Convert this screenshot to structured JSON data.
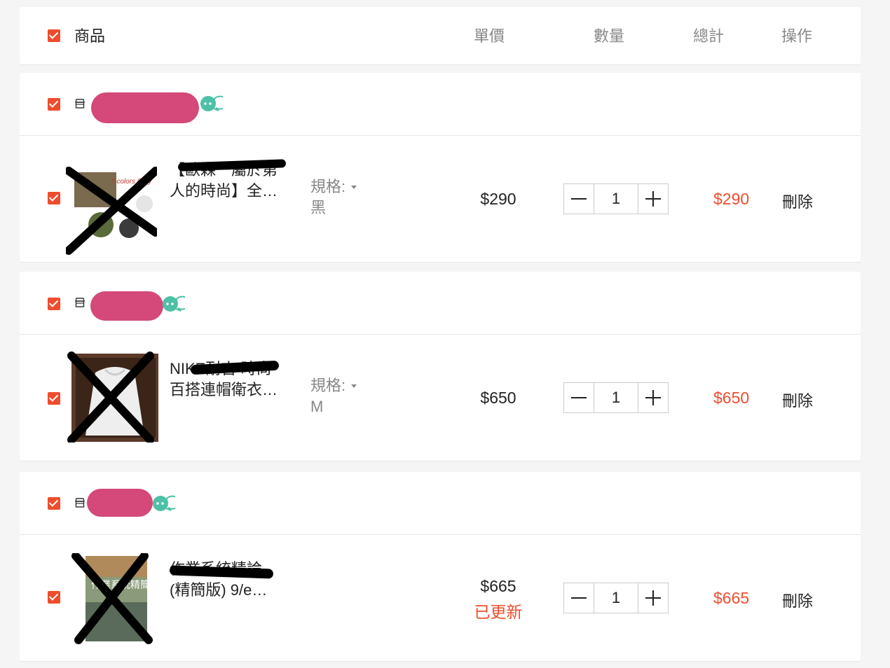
{
  "header": {
    "product": "商品",
    "unit_price": "單價",
    "quantity": "數量",
    "total": "總計",
    "actions": "操作"
  },
  "colors": {
    "accent": "#ee4d2d",
    "redact_blob": "#d4487a",
    "chat": "#4ec0a6"
  },
  "shops": [
    {
      "item": {
        "title_line1": "【歐森一屬於第",
        "title_line2": "人的時尚】全…",
        "spec_label": "規格:",
        "spec_value": "黑",
        "price": "$290",
        "quantity": "1",
        "total": "$290",
        "delete": "刪除",
        "thumb_text": "7 colors Only"
      }
    },
    {
      "item": {
        "title_line1": "NIKE耐吉 時尚",
        "title_line2": "百搭連帽衛衣…",
        "spec_label": "規格:",
        "spec_value": "M",
        "price": "$650",
        "quantity": "1",
        "total": "$650",
        "delete": "刪除"
      }
    },
    {
      "item": {
        "title_line1": "作業系統精論",
        "title_line2": "(精簡版) 9/e…",
        "price": "$665",
        "price_status": "已更新",
        "quantity": "1",
        "total": "$665",
        "delete": "刪除",
        "thumb_text": "作業系統精簡"
      }
    }
  ]
}
